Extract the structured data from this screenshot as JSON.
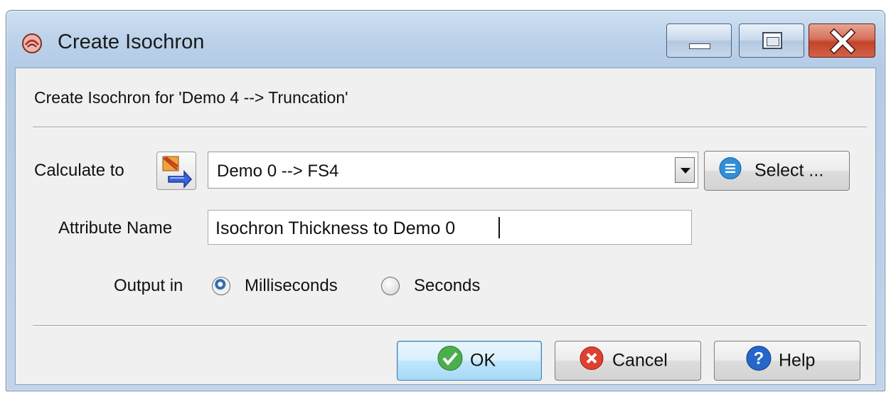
{
  "window": {
    "title": "Create Isochron",
    "icon": "app-icon"
  },
  "dialog": {
    "subtitle": "Create Isochron for 'Demo 4 --> Truncation'",
    "calculate_label": "Calculate to",
    "calculate_value": "Demo 0 --> FS4",
    "select_label": "Select ...",
    "attribute_label": "Attribute Name",
    "attribute_value": "Isochron Thickness to Demo 0",
    "output_label": "Output in",
    "output_options": [
      {
        "label": "Milliseconds",
        "selected": true
      },
      {
        "label": "Seconds",
        "selected": false
      }
    ]
  },
  "buttons": {
    "ok": "OK",
    "cancel": "Cancel",
    "help": "Help"
  },
  "colors": {
    "accent": "#3c7fb1",
    "close": "#c2432a",
    "ok_icon": "#3a9a3a",
    "cancel_icon": "#d83a2a",
    "help_icon": "#1f5fbf"
  }
}
